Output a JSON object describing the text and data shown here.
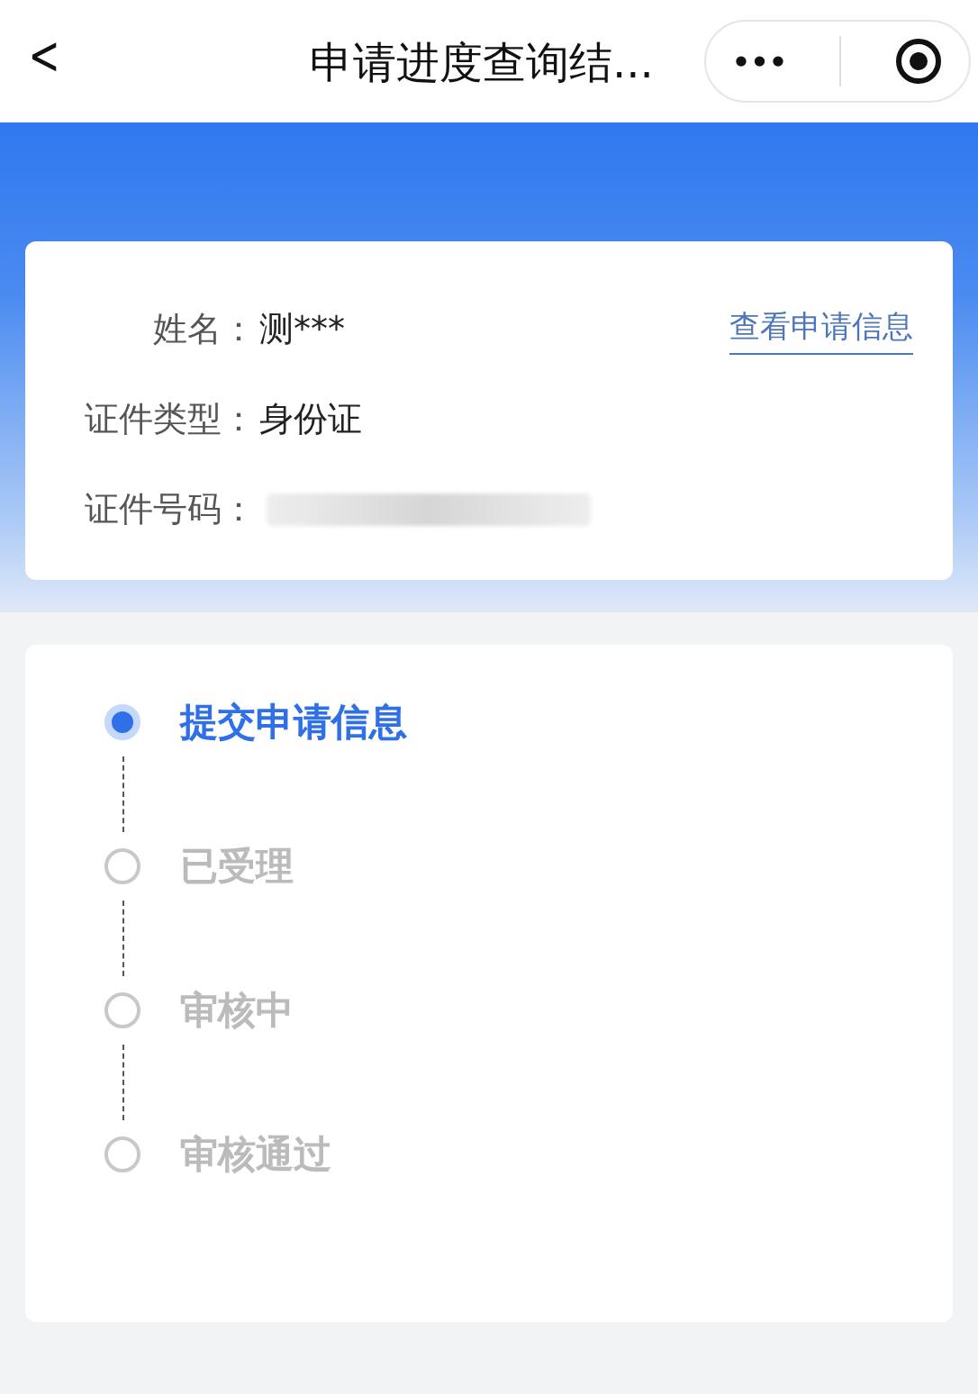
{
  "nav": {
    "back": "<",
    "title": "申请进度查询结...",
    "more": "•••"
  },
  "applicant": {
    "fields": [
      {
        "label": "姓名：",
        "value": "测***",
        "redacted": false
      },
      {
        "label": "证件类型：",
        "value": "身份证",
        "redacted": false
      },
      {
        "label": "证件号码：",
        "redacted": true
      }
    ],
    "link": "查看申请信息"
  },
  "steps": [
    {
      "label": "提交申请信息",
      "active": true
    },
    {
      "label": "已受理",
      "active": false
    },
    {
      "label": "审核中",
      "active": false
    },
    {
      "label": "审核通过",
      "active": false
    }
  ]
}
